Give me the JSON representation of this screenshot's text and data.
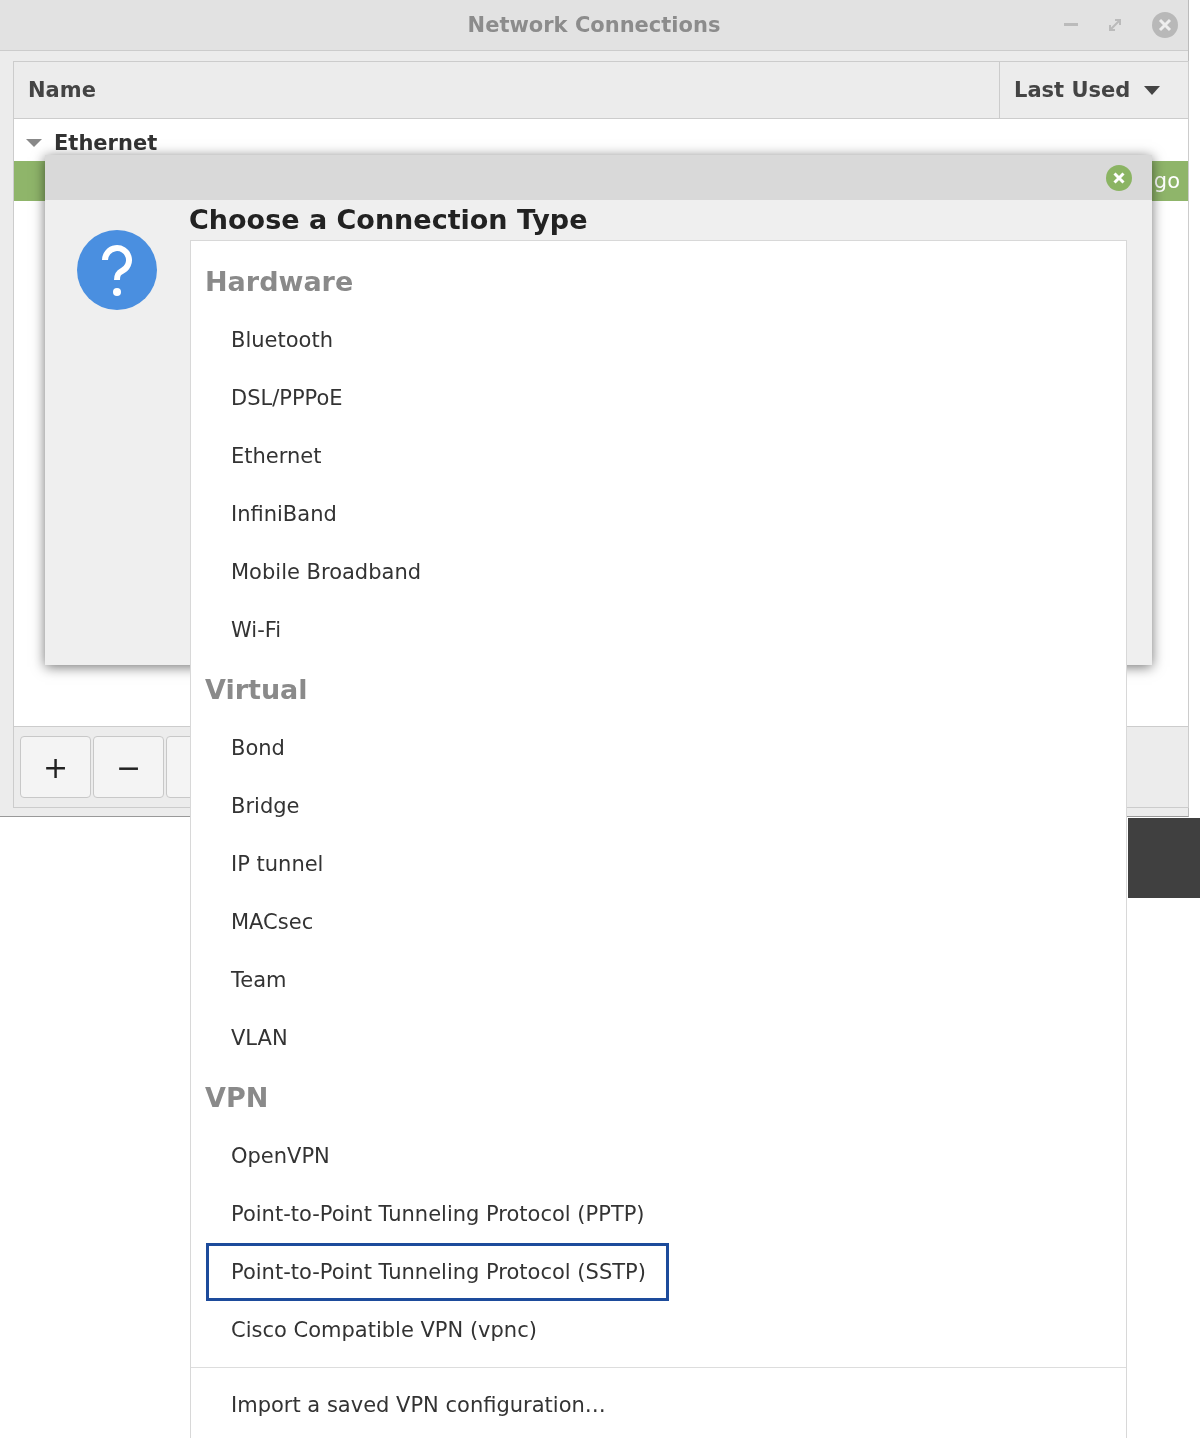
{
  "window": {
    "title": "Network Connections"
  },
  "table": {
    "columns": [
      {
        "label": "Name",
        "sorted": false
      },
      {
        "label": "Last Used",
        "sorted": true
      }
    ],
    "groups": [
      {
        "name": "Ethernet",
        "expanded": true,
        "rows": [
          {
            "last_used": "go",
            "selected": true
          }
        ]
      }
    ]
  },
  "toolbar": {
    "buttons": [
      "+",
      "−"
    ]
  },
  "dialog": {
    "heading": "Choose a Connection Type"
  },
  "menu": {
    "sections": [
      {
        "title": "Hardware",
        "items": [
          {
            "label": "Bluetooth",
            "selected": false
          },
          {
            "label": "DSL/PPPoE",
            "selected": false
          },
          {
            "label": "Ethernet",
            "selected": false
          },
          {
            "label": "InfiniBand",
            "selected": false
          },
          {
            "label": "Mobile Broadband",
            "selected": false
          },
          {
            "label": "Wi-Fi",
            "selected": false
          }
        ]
      },
      {
        "title": "Virtual",
        "items": [
          {
            "label": "Bond",
            "selected": false
          },
          {
            "label": "Bridge",
            "selected": false
          },
          {
            "label": "IP tunnel",
            "selected": false
          },
          {
            "label": "MACsec",
            "selected": false
          },
          {
            "label": "Team",
            "selected": false
          },
          {
            "label": "VLAN",
            "selected": false
          }
        ]
      },
      {
        "title": "VPN",
        "items": [
          {
            "label": "OpenVPN",
            "selected": false
          },
          {
            "label": "Point-to-Point Tunneling Protocol (PPTP)",
            "selected": false
          },
          {
            "label": "Point-to-Point Tunneling Protocol (SSTP)",
            "selected": true
          },
          {
            "label": "Cisco Compatible VPN (vpnc)",
            "selected": false
          }
        ]
      }
    ],
    "footer_item": "Import a saved VPN configuration…"
  }
}
